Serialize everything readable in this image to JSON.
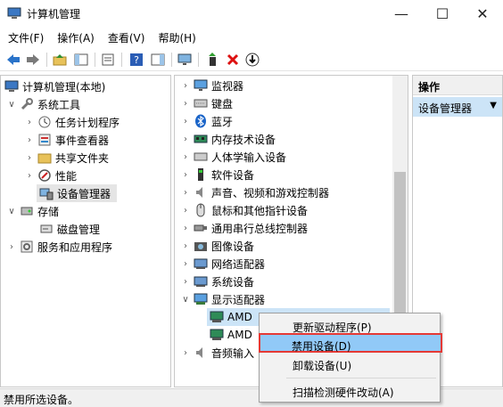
{
  "window": {
    "title": "计算机管理",
    "minimize": "—",
    "maximize": "☐",
    "close": "✕"
  },
  "menu": [
    "文件(F)",
    "操作(A)",
    "查看(V)",
    "帮助(H)"
  ],
  "left_tree": {
    "root": "计算机管理(本地)",
    "system_tools": "系统工具",
    "task_scheduler": "任务计划程序",
    "event_viewer": "事件查看器",
    "shared_folders": "共享文件夹",
    "performance": "性能",
    "device_manager": "设备管理器",
    "storage": "存储",
    "disk_management": "磁盘管理",
    "services_apps": "服务和应用程序"
  },
  "device_tree": {
    "monitors": "监视器",
    "keyboards": "键盘",
    "bluetooth": "蓝牙",
    "memory_tech": "内存技术设备",
    "hid": "人体学输入设备",
    "software_devices": "软件设备",
    "sound": "声音、视频和游戏控制器",
    "mice": "鼠标和其他指针设备",
    "usb": "通用串行总线控制器",
    "imaging": "图像设备",
    "network": "网络适配器",
    "system": "系统设备",
    "display": "显示适配器",
    "amd1": "AMD",
    "amd2": "AMD",
    "audio_io": "音频输入"
  },
  "actions": {
    "header": "操作",
    "item": "设备管理器",
    "arrow": "▼"
  },
  "context_menu": {
    "update_driver": "更新驱动程序(P)",
    "disable": "禁用设备(D)",
    "uninstall": "卸载设备(U)",
    "scan": "扫描检测硬件改动(A)"
  },
  "status": "禁用所选设备。"
}
